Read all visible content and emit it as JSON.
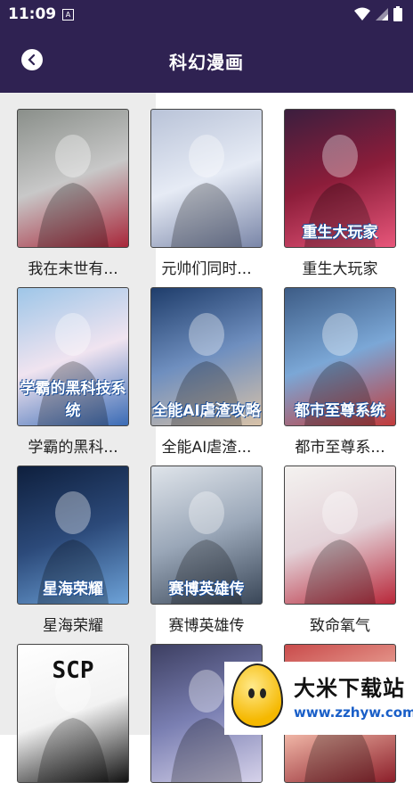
{
  "status_bar": {
    "time": "11:09",
    "notification_letter": "A"
  },
  "header": {
    "title": "科幻漫画"
  },
  "colors": {
    "header_bg": "#2f2252",
    "sidebar_bg": "#ececec"
  },
  "comics": [
    {
      "title": "我在末世有...",
      "cover_text": "",
      "cover_colors": [
        "#8a8f8a",
        "#c8c8c8",
        "#a8273a"
      ]
    },
    {
      "title": "元帅们同时...",
      "cover_text": "",
      "cover_colors": [
        "#b9c3d8",
        "#e6ebf5",
        "#7a86a8"
      ]
    },
    {
      "title": "重生大玩家",
      "cover_text": "重生大玩家",
      "cover_colors": [
        "#3b1e3e",
        "#8c1d3a",
        "#e7567a"
      ]
    },
    {
      "title": "学霸的黑科...",
      "cover_text": "学霸的黑科技系统",
      "cover_colors": [
        "#9ec6e8",
        "#f0e4f0",
        "#3a6bb5"
      ]
    },
    {
      "title": "全能AI虐渣...",
      "cover_text": "全能AI虐渣攻略",
      "cover_colors": [
        "#1f3d6b",
        "#6f8fbf",
        "#d8c2a8"
      ]
    },
    {
      "title": "都市至尊系...",
      "cover_text": "都市至尊系统",
      "cover_colors": [
        "#3d5c86",
        "#7ba7d6",
        "#c23b3b"
      ]
    },
    {
      "title": "星海荣耀",
      "cover_text": "星海荣耀",
      "cover_colors": [
        "#0e1f3d",
        "#2c4a7a",
        "#6da2d8"
      ]
    },
    {
      "title": "赛博英雄传",
      "cover_text": "赛博英雄传",
      "cover_colors": [
        "#dfe4ea",
        "#9aa7b8",
        "#3a4758"
      ]
    },
    {
      "title": "致命氧气",
      "cover_text": "",
      "cover_colors": [
        "#f4f2f0",
        "#e3d2d8",
        "#b8283a"
      ]
    },
    {
      "title": "",
      "cover_text": "SCP",
      "cover_colors": [
        "#ffffff",
        "#f2f2f2",
        "#111111"
      ]
    },
    {
      "title": "",
      "cover_text": "",
      "cover_colors": [
        "#3d3f62",
        "#7a7fb2",
        "#d6d2ea"
      ]
    },
    {
      "title": "",
      "cover_text": "",
      "cover_colors": [
        "#c94b4b",
        "#f1b8a8",
        "#8c1f2a"
      ]
    }
  ],
  "watermark": {
    "name": "大米下载站",
    "url": "www.zzhyw.com"
  }
}
